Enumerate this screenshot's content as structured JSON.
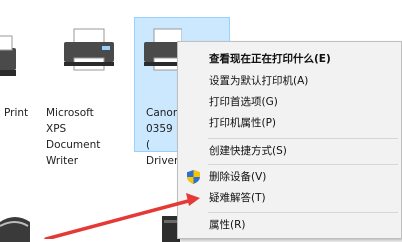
{
  "devices": [
    {
      "label": "Print"
    },
    {
      "label": "Microsoft XPS\nDocument\nWriter"
    },
    {
      "label": "Canon\n0359 (\nDriver"
    }
  ],
  "context_menu": {
    "items": [
      {
        "label": "查看现在正在打印什么(E)"
      },
      {
        "label": "设置为默认打印机(A)"
      },
      {
        "label": "打印首选项(G)"
      },
      {
        "label": "打印机属性(P)"
      },
      {
        "label": "创建快捷方式(S)"
      },
      {
        "label": "删除设备(V)"
      },
      {
        "label": "疑难解答(T)"
      },
      {
        "label": "属性(R)"
      }
    ]
  },
  "colors": {
    "selection": "#cce8ff",
    "arrow": "#e53935",
    "shield_blue": "#2f6fd1",
    "shield_yellow": "#f6c700"
  }
}
